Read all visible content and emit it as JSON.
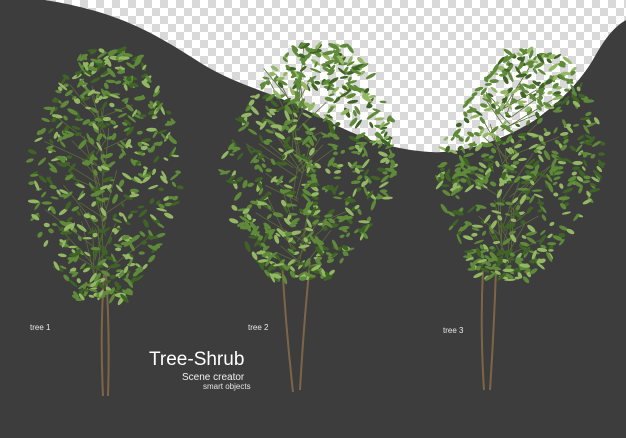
{
  "colors": {
    "background": "#3d3d3d",
    "checker_light": "#ffffff",
    "checker_dark": "#d9d9d9",
    "leaf_dark": "#3f6425",
    "leaf_mid": "#5f8a3a",
    "leaf_light": "#93b764",
    "stem": "#7d6548",
    "text": "#ffffff"
  },
  "trees": [
    {
      "label": "tree 1"
    },
    {
      "label": "tree 2"
    },
    {
      "label": "tree 3"
    }
  ],
  "branding": {
    "title": "Tree-Shrub",
    "subtitle": "Scene creator",
    "tagline": "smart objects"
  }
}
